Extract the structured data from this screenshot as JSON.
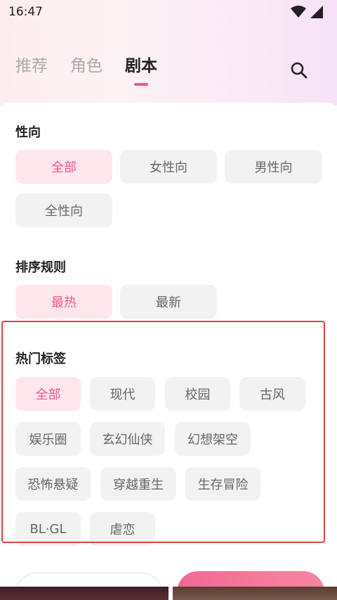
{
  "status": {
    "time": "16:47"
  },
  "tabs": [
    {
      "label": "推荐"
    },
    {
      "label": "角色"
    },
    {
      "label": "剧本"
    }
  ],
  "sections": {
    "orientation": {
      "title": "性向",
      "options": [
        "全部",
        "女性向",
        "男性向",
        "全性向"
      ]
    },
    "sort": {
      "title": "排序规则",
      "options": [
        "最热",
        "最新"
      ]
    },
    "hot_tags": {
      "title": "热门标签",
      "options": [
        "全部",
        "现代",
        "校园",
        "古风",
        "娱乐圈",
        "玄幻仙侠",
        "幻想架空",
        "恐怖悬疑",
        "穿越重生",
        "生存冒险",
        "BL·GL",
        "虐恋"
      ]
    }
  },
  "colors": {
    "accent": "#f05b85",
    "chip_selected_bg": "#fde6ec",
    "chip_bg": "#f2f2f3",
    "highlight": "#d9443a"
  },
  "icons": [
    "wifi-icon",
    "signal-icon",
    "search-icon"
  ]
}
